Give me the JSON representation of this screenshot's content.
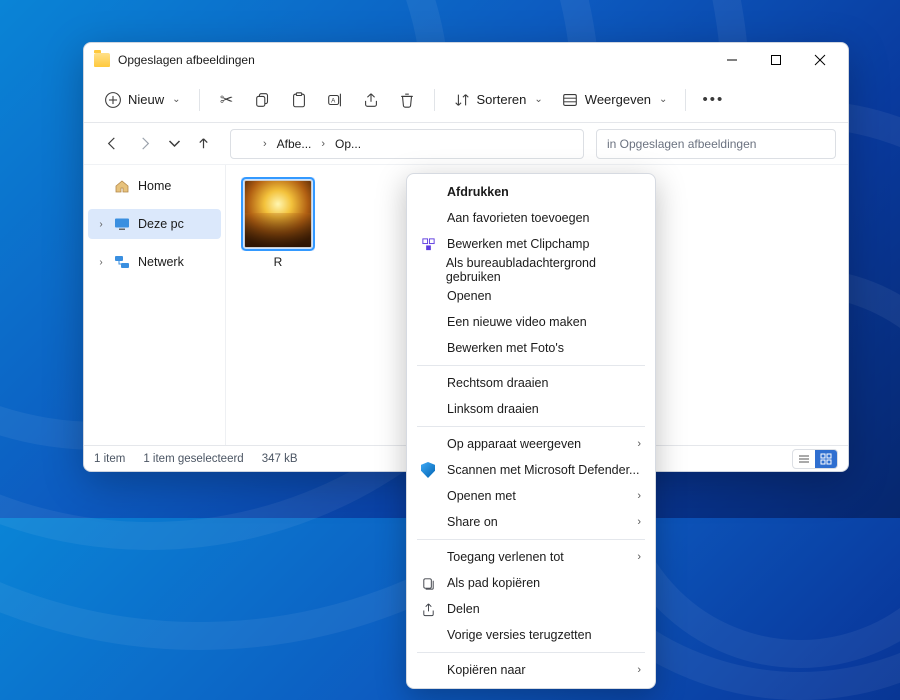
{
  "title": "Opgeslagen afbeeldingen",
  "win_controls": {
    "min": "minimize",
    "max": "maximize",
    "close": "close"
  },
  "toolbar": {
    "new_label": "Nieuw",
    "sort_label": "Sorteren",
    "view_label": "Weergeven",
    "icons": {
      "cut": "cut",
      "copy": "copy",
      "paste": "paste",
      "rename": "rename",
      "share": "share",
      "delete": "delete",
      "sort": "sort",
      "view": "view",
      "more": "more"
    }
  },
  "nav": {
    "crumb1": "Afbe...",
    "crumb2": "Op...",
    "search_placeholder": "in Opgeslagen afbeeldingen"
  },
  "sidebar": {
    "home": "Home",
    "pc": "Deze pc",
    "network": "Netwerk"
  },
  "content": {
    "thumb1_caption": "R"
  },
  "status": {
    "count": "1 item",
    "selection": "1 item geselecteerd",
    "size": "347 kB"
  },
  "ctx": {
    "g1": [
      {
        "label": "Afdrukken",
        "bold": true
      },
      {
        "label": "Aan favorieten toevoegen"
      },
      {
        "label": "Bewerken met Clipchamp",
        "icon": "clipchamp"
      },
      {
        "label": "Als bureaubladachtergrond gebruiken"
      },
      {
        "label": "Openen"
      },
      {
        "label": "Een nieuwe video maken"
      },
      {
        "label": "Bewerken met Foto's"
      }
    ],
    "g2": [
      {
        "label": "Rechtsom draaien"
      },
      {
        "label": "Linksom draaien"
      }
    ],
    "g3": [
      {
        "label": "Op apparaat weergeven",
        "sub": true
      },
      {
        "label": "Scannen met Microsoft Defender...",
        "icon": "defender"
      },
      {
        "label": "Openen met",
        "sub": true
      },
      {
        "label": "Share on",
        "sub": true
      }
    ],
    "g4": [
      {
        "label": "Toegang verlenen tot",
        "sub": true
      },
      {
        "label": "Als pad kopiëren",
        "icon": "copypath"
      },
      {
        "label": "Delen",
        "icon": "share"
      },
      {
        "label": "Vorige versies terugzetten"
      }
    ],
    "g5": [
      {
        "label": "Kopiëren naar",
        "sub": true
      }
    ]
  }
}
